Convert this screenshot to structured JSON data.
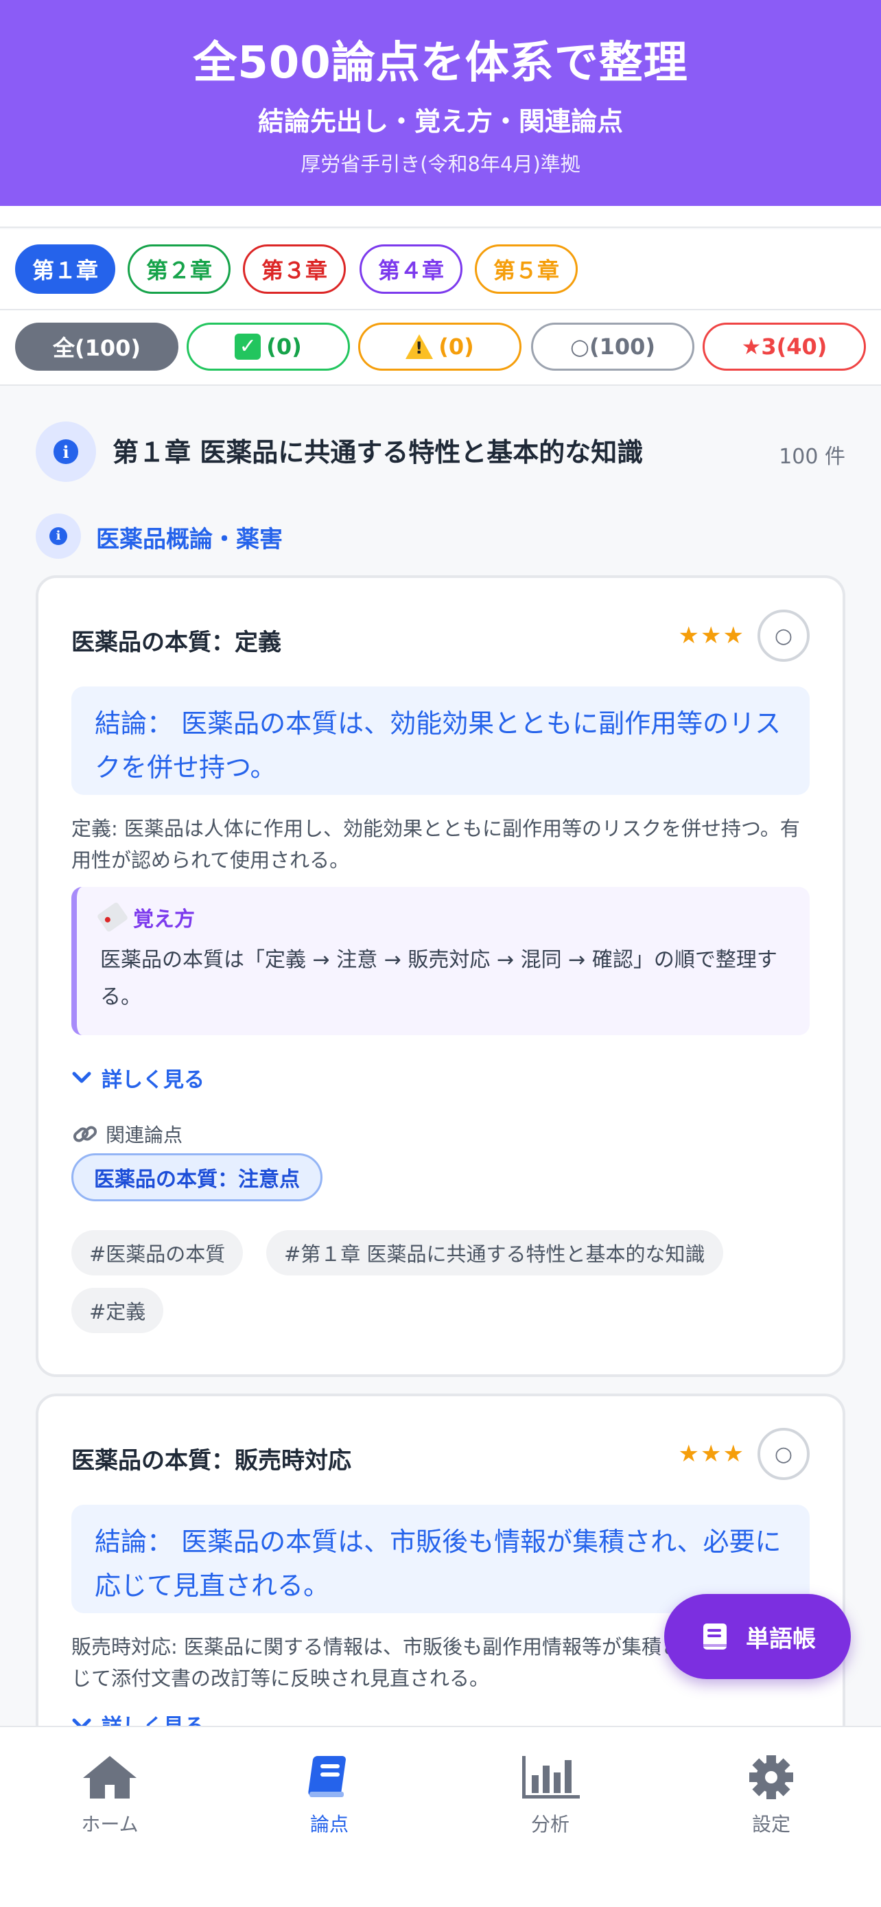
{
  "hero": {
    "title": "全500論点を体系で整理",
    "subtitle": "結論先出し・覚え方・関連論点",
    "source": "厚労省手引き(令和8年4月)準拠"
  },
  "chapters": [
    {
      "label": "第１章",
      "color": "#2563eb",
      "active": true
    },
    {
      "label": "第２章",
      "color": "#16a34a",
      "active": false
    },
    {
      "label": "第３章",
      "color": "#dc2626",
      "active": false
    },
    {
      "label": "第４章",
      "color": "#7c3aed",
      "active": false
    },
    {
      "label": "第５章",
      "color": "#f59e0b",
      "active": false
    }
  ],
  "filters": {
    "all": "全(100)",
    "done_count": "(0)",
    "warn_count": "(0)",
    "unseen": "○(100)",
    "starred": "★3(40)"
  },
  "chapter_section": {
    "title": "第１章 医薬品に共通する特性と基本的な知識",
    "count": "100 件",
    "subsection": "医薬品概論・薬害"
  },
  "cards": [
    {
      "title": "医薬品の本質：定義",
      "stars": "★★★",
      "status": "○",
      "conclusion": "結論： 医薬品の本質は、効能効果とともに副作用等のリスクを併せ持つ。",
      "definition": "定義: 医薬品は人体に作用し、効能効果とともに副作用等のリスクを併せ持つ。有用性が認められて使用される。",
      "memo_label": "覚え方",
      "memo_text": "医薬品の本質は「定義 → 注意 → 販売対応 → 混同 → 確認」の順で整理する。",
      "more": "詳しく見る",
      "related_label": "関連論点",
      "related_chip": "医薬品の本質：注意点",
      "tags": [
        "#医薬品の本質",
        "#第１章 医薬品に共通する特性と基本的な知識",
        "#定義"
      ]
    },
    {
      "title": "医薬品の本質：販売時対応",
      "stars": "★★★",
      "status": "○",
      "conclusion": "結論： 医薬品の本質は、市販後も情報が集積され、必要に応じて見直される。",
      "definition": "販売時対応: 医薬品に関する情報は、市販後も副作用情報等が集積され、必要に応じて添付文書の改訂等に反映され見直される。",
      "more": "詳しく見る"
    }
  ],
  "fab": {
    "label": "単語帳"
  },
  "bottom_nav": [
    {
      "label": "ホーム",
      "icon": "home-icon",
      "active": false
    },
    {
      "label": "論点",
      "icon": "book-icon",
      "active": true
    },
    {
      "label": "分析",
      "icon": "bar-chart-icon",
      "active": false
    },
    {
      "label": "設定",
      "icon": "gear-icon",
      "active": false
    }
  ],
  "colors": {
    "hero_bg": "#8b5cf6",
    "accent_blue": "#2563eb",
    "fab_bg": "#7c2fe0"
  }
}
